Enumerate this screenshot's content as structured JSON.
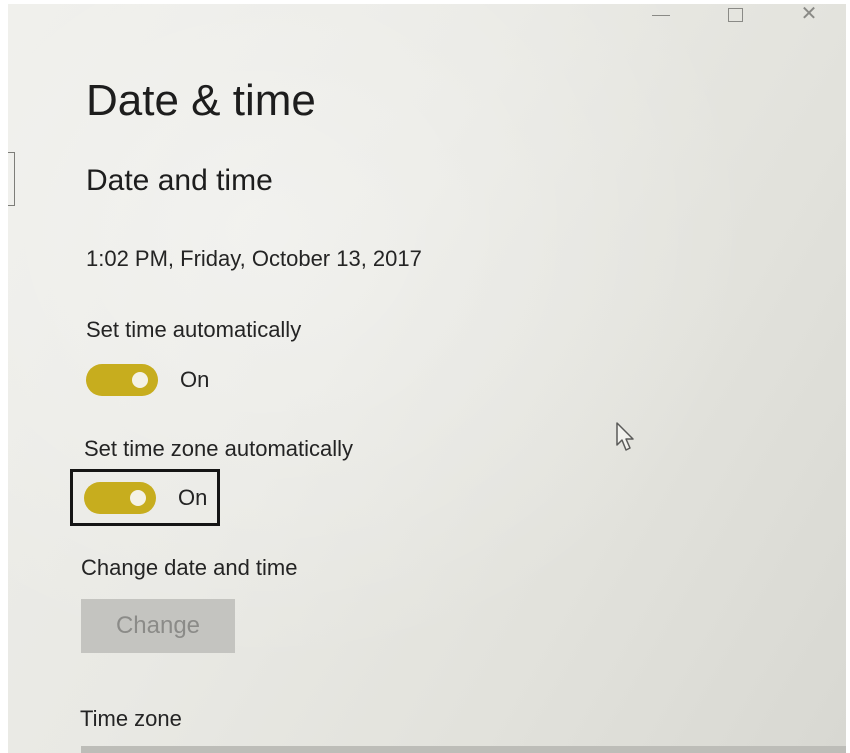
{
  "window": {
    "controls": {
      "minimize_icon": "minimize-icon",
      "maximize_icon": "maximize-icon",
      "close_icon": "close-icon",
      "close_glyph": "✕"
    }
  },
  "page": {
    "title": "Date & time"
  },
  "section": {
    "title": "Date and time",
    "current_datetime": "1:02 PM, Friday, October 13, 2017"
  },
  "settings": {
    "set_time_automatically": {
      "label": "Set time automatically",
      "state": "On",
      "enabled": true
    },
    "set_time_zone_automatically": {
      "label": "Set time zone automatically",
      "state": "On",
      "enabled": true
    },
    "change_date_and_time": {
      "label": "Change date and time",
      "button_label": "Change",
      "disabled": true
    },
    "time_zone": {
      "label": "Time zone"
    }
  },
  "colors": {
    "accent": "#c7ad1e",
    "background": "#e9e9e4",
    "text": "#242424",
    "disabled_button_bg": "#c4c4c0",
    "disabled_button_text": "#8b8b88"
  }
}
